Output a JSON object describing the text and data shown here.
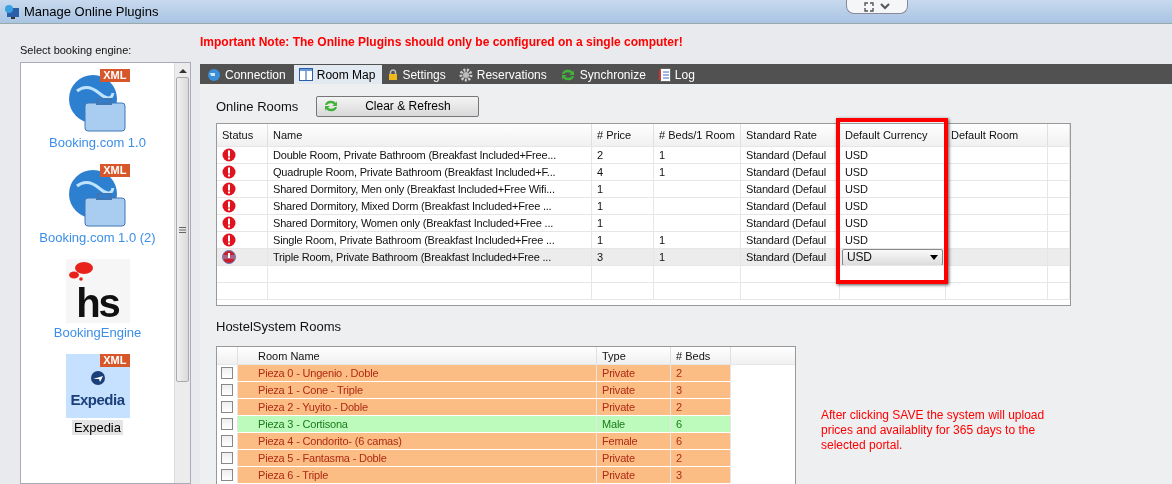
{
  "window": {
    "title": "Manage Online Plugins"
  },
  "note": "Important Note: The Online Plugins should only be configured on a single computer!",
  "sidebar": {
    "label": "Select booking engine:",
    "items": [
      {
        "kind": "xml",
        "badge": "XML",
        "label": "Booking.com 1.0",
        "selected": false
      },
      {
        "kind": "xml",
        "badge": "XML",
        "label": "Booking.com 1.0 (2)",
        "selected": false
      },
      {
        "kind": "hs",
        "logo_text": "hs",
        "label": "BookingEngine",
        "selected": false
      },
      {
        "kind": "expedia",
        "badge": "XML",
        "logo_text": "Expedia",
        "label": "Expedia",
        "selected": true
      }
    ]
  },
  "tabs": [
    {
      "label": "Connection",
      "selected": false
    },
    {
      "label": "Room Map",
      "selected": true
    },
    {
      "label": "Settings",
      "selected": false
    },
    {
      "label": "Reservations",
      "selected": false
    },
    {
      "label": "Synchronize",
      "selected": false
    },
    {
      "label": "Log",
      "selected": false
    }
  ],
  "online_rooms": {
    "title": "Online Rooms",
    "button": "Clear & Refresh",
    "columns": [
      "Status",
      "Name",
      "# Price",
      "# Beds/1 Room",
      "Standard Rate",
      "Default Currency",
      "Default Room"
    ],
    "rows": [
      {
        "name": "Double Room, Private Bathroom (Breakfast Included+Free...",
        "price": "2",
        "beds": "1",
        "rate": "Standard (Defaul",
        "currency": "USD",
        "selected": false
      },
      {
        "name": "Quadruple Room, Private Bathroom (Breakfast Included+F...",
        "price": "4",
        "beds": "1",
        "rate": "Standard (Defaul",
        "currency": "USD",
        "selected": false
      },
      {
        "name": "Shared Dormitory, Men only (Breakfast Included+Free Wifi...",
        "price": "1",
        "rate": "Standard (Defaul",
        "currency": "USD",
        "selected": false
      },
      {
        "name": "Shared Dormitory, Mixed Dorm (Breakfast Included+Free ...",
        "price": "1",
        "rate": "Standard (Defaul",
        "currency": "USD",
        "selected": false
      },
      {
        "name": "Shared Dormitory, Women only (Breakfast Included+Free ...",
        "price": "1",
        "rate": "Standard (Defaul",
        "currency": "USD",
        "selected": false
      },
      {
        "name": "Single Room, Private Bathroom (Breakfast Included+Free ...",
        "price": "1",
        "beds": "1",
        "rate": "Standard (Defaul",
        "currency": "USD",
        "selected": false
      },
      {
        "name": "Triple Room, Private Bathroom (Breakfast Included+Free ...",
        "price": "3",
        "beds": "1",
        "rate": "Standard (Defaul",
        "currency": "USD",
        "selected": true
      }
    ]
  },
  "hostel_rooms": {
    "title": "HostelSystem Rooms",
    "columns": [
      "Room Name",
      "Type",
      "# Beds"
    ],
    "rows": [
      {
        "name": "Pieza 0 - Ungenio . Doble",
        "type": "Private",
        "beds": "2",
        "color": "#fbbd84",
        "checked": false
      },
      {
        "name": "Pieza 1 - Cone - Triple",
        "type": "Private",
        "beds": "3",
        "color": "#fbbd84",
        "checked": false
      },
      {
        "name": "Pieza 2 - Yuyito - Doble",
        "type": "Private",
        "beds": "2",
        "color": "#fbbd84",
        "checked": false
      },
      {
        "name": "Pieza 3 - Cortisona",
        "type": "Male",
        "beds": "6",
        "color": "#bdfbbd",
        "checked": false
      },
      {
        "name": "Pieza 4 - Condorito- (6 camas)",
        "type": "Female",
        "beds": "6",
        "color": "#fbbd84",
        "checked": false
      },
      {
        "name": "Pieza 5 - Fantasma - Doble",
        "type": "Private",
        "beds": "2",
        "color": "#fbbd84",
        "checked": false
      },
      {
        "name": "Pieza 6 - Triple",
        "type": "Private",
        "beds": "3",
        "color": "#fbbd84",
        "checked": false
      }
    ]
  },
  "save_note": "After clicking SAVE the system will upload prices and availablity for 365 days to the selected portal."
}
